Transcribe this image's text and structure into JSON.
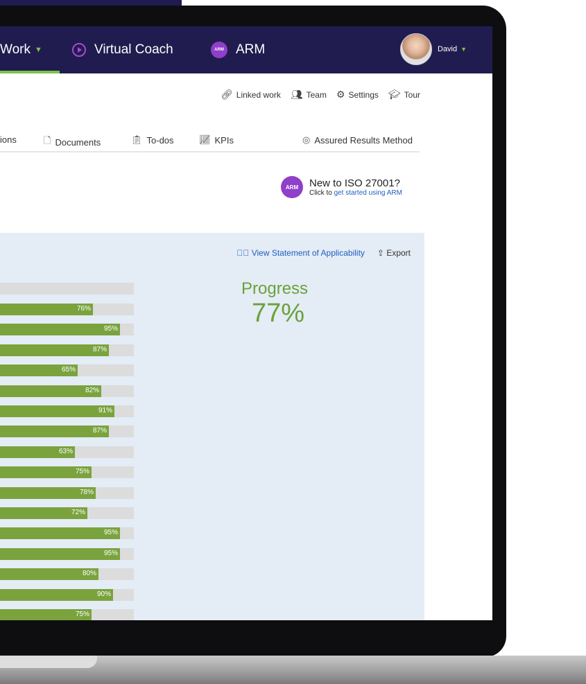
{
  "nav": {
    "work_label": "Work",
    "coach_label": "Virtual Coach",
    "arm_label": "ARM",
    "arm_badge": "ARM",
    "user_name": "David"
  },
  "utility": {
    "linked_work": "Linked work",
    "team": "Team",
    "settings": "Settings",
    "tour": "Tour"
  },
  "tabs": [
    {
      "label": "ions",
      "icon": ""
    },
    {
      "label": "Documents",
      "icon": "document-icon"
    },
    {
      "label": "To-dos",
      "icon": "clipboard-icon"
    },
    {
      "label": "KPIs",
      "icon": "chart-icon"
    },
    {
      "label": "Assured Results Method",
      "icon": "target-icon"
    }
  ],
  "promo": {
    "title": "New to ISO 27001?",
    "sub_prefix": "Click to ",
    "sub_link": "get started using ARM"
  },
  "actions": {
    "view_soa": "View Statement of Applicability",
    "export": "Export"
  },
  "progress": {
    "label": "Progress",
    "value": "77%"
  },
  "bars": [
    {
      "pct": 76,
      "label": "76%"
    },
    {
      "pct": 95,
      "label": "95%"
    },
    {
      "pct": 87,
      "label": "87%"
    },
    {
      "pct": 65,
      "label": "65%"
    },
    {
      "pct": 82,
      "label": "82%"
    },
    {
      "pct": 91,
      "label": "91%"
    },
    {
      "pct": 87,
      "label": "87%"
    },
    {
      "pct": 63,
      "label": "63%"
    },
    {
      "pct": 75,
      "label": "75%"
    },
    {
      "pct": 78,
      "label": "78%"
    },
    {
      "pct": 72,
      "label": "72%"
    },
    {
      "pct": 95,
      "label": "95%"
    },
    {
      "pct": 95,
      "label": "95%"
    },
    {
      "pct": 80,
      "label": "80%"
    },
    {
      "pct": 90,
      "label": "90%"
    },
    {
      "pct": 75,
      "label": "75%"
    }
  ],
  "colors": {
    "nav_bg": "#211c4f",
    "accent_green": "#7bc34a",
    "bar_green": "#7aa33e",
    "progress_green": "#6aa13b",
    "purple": "#a44ad4",
    "link_blue": "#1f5fbf"
  }
}
